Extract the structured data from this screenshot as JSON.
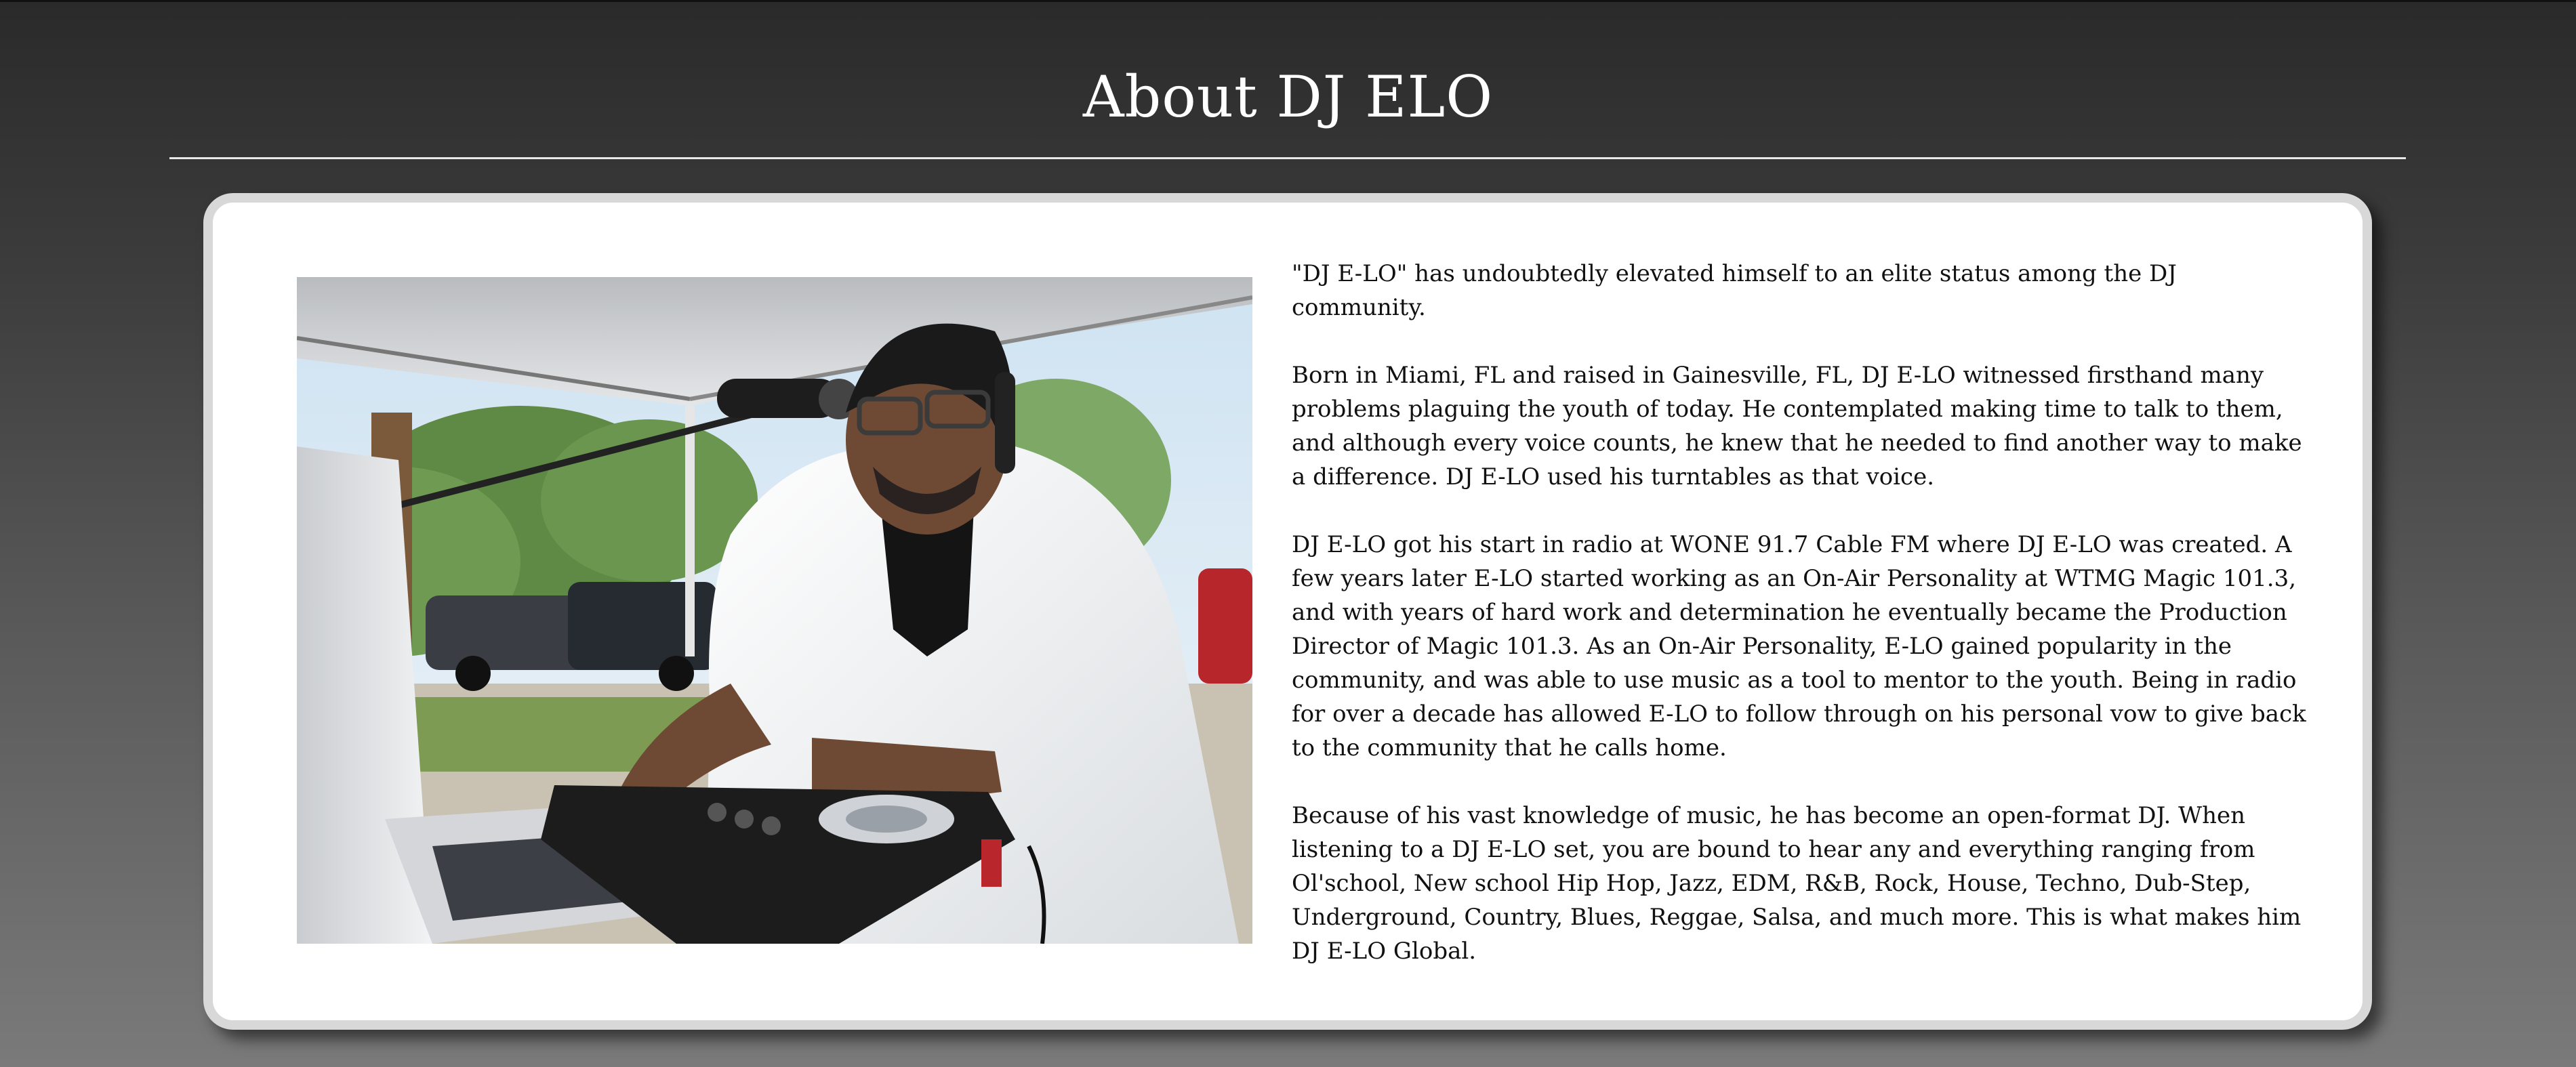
{
  "page": {
    "title": "About DJ ELO"
  },
  "photo": {
    "alt": "DJ E-LO mixing on turntables under a white tent"
  },
  "bio": {
    "paragraphs": [
      "\"DJ E-LO\" has undoubtedly elevated himself to an elite status among the DJ community.",
      "Born in Miami, FL and raised in Gainesville, FL, DJ E-LO witnessed firsthand many problems plaguing the youth of today. He contemplated making time to talk to them, and although every voice counts, he knew that he needed to find another way to make a difference. DJ E-LO used his turntables as that voice.",
      "DJ E-LO got his start in radio at WONE 91.7 Cable FM where DJ E-LO was created. A few years later E-LO started working as an On-Air Personality at WTMG Magic 101.3, and with years of hard work and determination he eventually became the Production Director of Magic 101.3. As an On-Air Personality, E-LO gained popularity in the community, and was able to use music as a tool to mentor to the youth. Being in radio for over a decade has allowed E-LO to follow through on his personal vow to give back to the community that he calls home.",
      "Because of his vast knowledge of music, he has become an open-format DJ. When listening to a DJ E-LO set, you are bound to hear any and everything ranging from Ol'school, New school Hip Hop, Jazz, EDM, R&B, Rock, House, Techno, Dub-Step, Underground, Country, Blues, Reggae, Salsa, and much more. This is what makes him DJ E-LO Global."
    ]
  }
}
